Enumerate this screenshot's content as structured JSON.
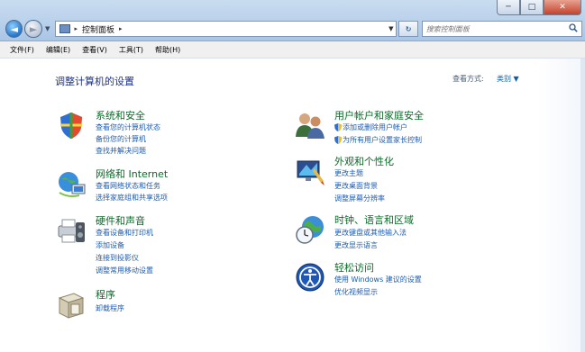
{
  "window": {
    "min_label": "─",
    "max_label": "□",
    "close_label": "✕"
  },
  "nav": {
    "back_label": "◄",
    "forward_label": "►",
    "history_label": "▼",
    "address_text": "控制面板",
    "address_sep": "▸",
    "address_dropdown": "▼",
    "refresh_label": "↻",
    "search_placeholder": "搜索控制面板"
  },
  "menu": [
    {
      "label": "文件(F)"
    },
    {
      "label": "编辑(E)"
    },
    {
      "label": "查看(V)"
    },
    {
      "label": "工具(T)"
    },
    {
      "label": "帮助(H)"
    }
  ],
  "page": {
    "title": "调整计算机的设置",
    "view_by_label": "查看方式:",
    "view_by_value": "类别 ▼"
  },
  "categories": {
    "system": {
      "title": "系统和安全",
      "links": [
        "查看您的计算机状态",
        "备份您的计算机",
        "查找并解决问题"
      ]
    },
    "network": {
      "title": "网络和 Internet",
      "links": [
        "查看网络状态和任务",
        "选择家庭组和共享选项"
      ]
    },
    "hardware": {
      "title": "硬件和声音",
      "links": [
        "查看设备和打印机",
        "添加设备",
        "连接到投影仪",
        "调整常用移动设置"
      ]
    },
    "programs": {
      "title": "程序",
      "links": [
        "卸载程序"
      ]
    },
    "users": {
      "title": "用户帐户和家庭安全",
      "links": [
        "添加或删除用户帐户",
        "为所有用户设置家长控制"
      ]
    },
    "appearance": {
      "title": "外观和个性化",
      "links": [
        "更改主题",
        "更改桌面背景",
        "调整屏幕分辨率"
      ]
    },
    "clock": {
      "title": "时钟、语言和区域",
      "links": [
        "更改键盘或其他输入法",
        "更改显示语言"
      ]
    },
    "access": {
      "title": "轻松访问",
      "links": [
        "使用 Windows 建议的设置",
        "优化视频显示"
      ]
    }
  }
}
